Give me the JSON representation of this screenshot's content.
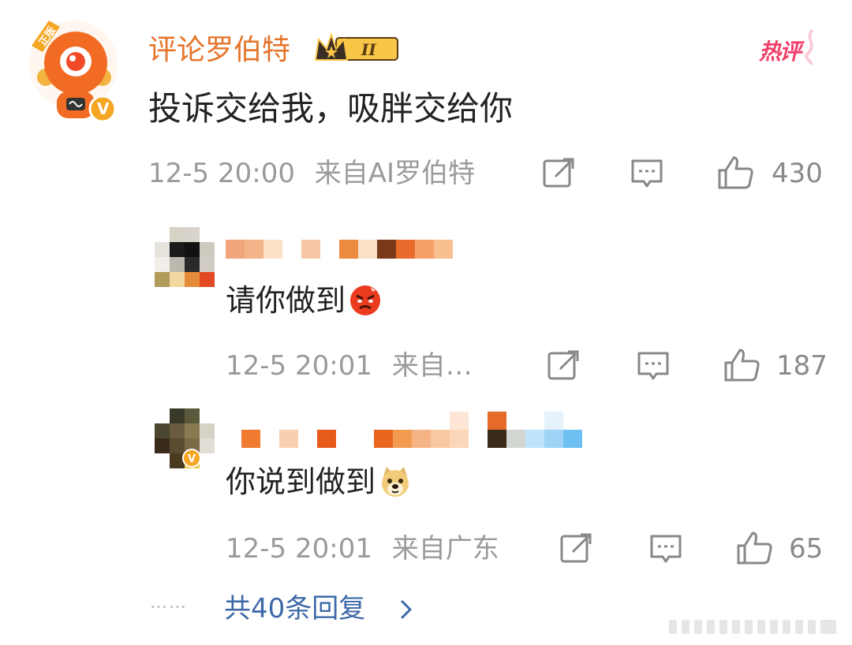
{
  "comment": {
    "username": "评论罗伯特",
    "badge_label": "正版",
    "level_badge": "II",
    "hot_tag": "热评",
    "text": "投诉交给我，吸胖交给你",
    "time": "12-5 20:00",
    "source": "来自AI罗伯特",
    "likes": "430",
    "verified_mark": "V"
  },
  "replies": [
    {
      "text": "请你做到",
      "emoji": "angry-face-emoji",
      "time": "12-5 20:01",
      "source": "来自…",
      "likes": "187"
    },
    {
      "text": "你说到做到",
      "emoji": "doge-emoji",
      "time": "12-5 20:01",
      "source": "来自广东",
      "likes": "65"
    }
  ],
  "footer": {
    "dots": "……",
    "more_replies": "共40条回复"
  },
  "icons": [
    "share-icon",
    "comment-icon",
    "like-icon",
    "chevron-right-icon"
  ],
  "colors": {
    "username": "#e5742a",
    "hot": "#f0406a",
    "link": "#3d68a8",
    "meta": "#9a9a9a"
  }
}
